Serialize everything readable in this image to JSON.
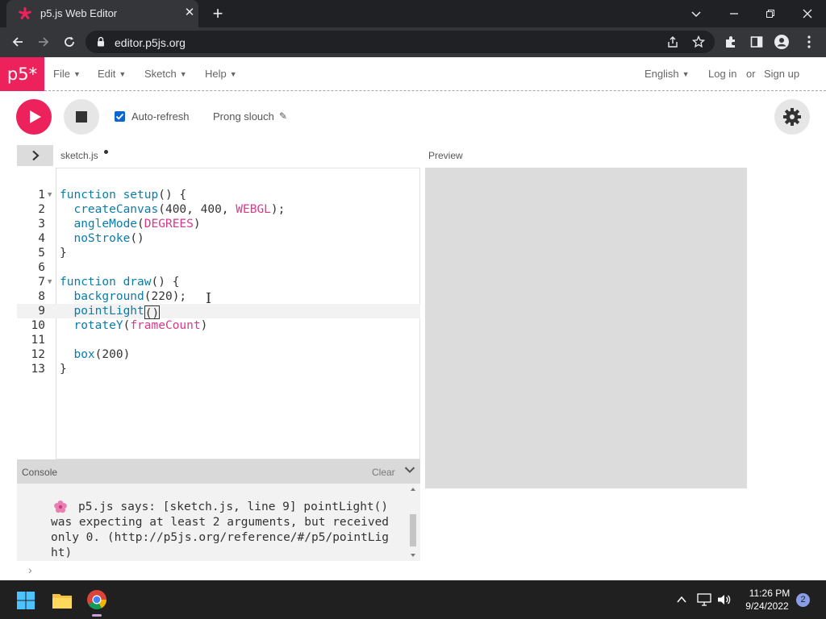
{
  "browser": {
    "tab_title": "p5.js Web Editor",
    "tab_close": "✕",
    "new_tab": "+",
    "url": "editor.p5js.org"
  },
  "app": {
    "logo": "p5*",
    "menu": [
      {
        "label": "File"
      },
      {
        "label": "Edit"
      },
      {
        "label": "Sketch"
      },
      {
        "label": "Help"
      }
    ],
    "language": "English",
    "login": "Log in",
    "or": "or",
    "signup": "Sign up"
  },
  "toolbar": {
    "autorefresh_label": "Auto-refresh",
    "autorefresh_checked": true,
    "sketch_name": "Prong slouch"
  },
  "editor": {
    "file_name": "sketch.js",
    "preview_label": "Preview",
    "lines": [
      {
        "n": "1",
        "text": "function setup() {"
      },
      {
        "n": "2",
        "text": "  createCanvas(400, 400, WEBGL);"
      },
      {
        "n": "3",
        "text": "  angleMode(DEGREES)"
      },
      {
        "n": "4",
        "text": "  noStroke()"
      },
      {
        "n": "5",
        "text": "}"
      },
      {
        "n": "6",
        "text": ""
      },
      {
        "n": "7",
        "text": "function draw() {"
      },
      {
        "n": "8",
        "text": "  background(220);"
      },
      {
        "n": "9",
        "text": "  pointLight()"
      },
      {
        "n": "10",
        "text": "  rotateY(frameCount)"
      },
      {
        "n": "11",
        "text": ""
      },
      {
        "n": "12",
        "text": "  box(200)"
      },
      {
        "n": "13",
        "text": "}"
      }
    ]
  },
  "console": {
    "label": "Console",
    "clear": "Clear",
    "message": "p5.js says: [sketch.js, line 9] pointLight() was expecting at least 2 arguments, but received only 0. (http://p5js.org/reference/#/p5/pointLight)",
    "prompt": "›"
  },
  "taskbar": {
    "time": "11:26 PM",
    "date": "9/24/2022",
    "notifications": "2"
  },
  "colors": {
    "p5_pink": "#ed225d",
    "chrome_dark": "#202124",
    "chrome_mid": "#35363a",
    "code_blue": "#0b7ca9",
    "code_pink": "#dc3787"
  }
}
